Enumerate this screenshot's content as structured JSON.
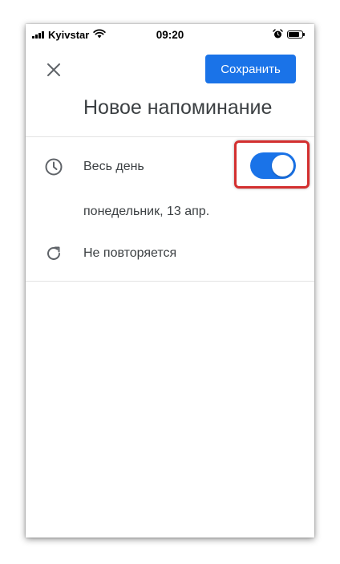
{
  "status_bar": {
    "carrier": "Kyivstar",
    "time": "09:20"
  },
  "header": {
    "close_icon": "close-icon",
    "save_label": "Сохранить",
    "title": "Новое напоминание"
  },
  "rows": {
    "all_day": {
      "icon": "clock-icon",
      "label": "Весь день",
      "toggle_on": true
    },
    "date": {
      "label": "понедельник, 13 апр."
    },
    "repeat": {
      "icon": "repeat-icon",
      "label": "Не повторяется"
    }
  },
  "colors": {
    "accent": "#1a73e8",
    "text": "#3c4043",
    "highlight": "#d32f2f"
  }
}
